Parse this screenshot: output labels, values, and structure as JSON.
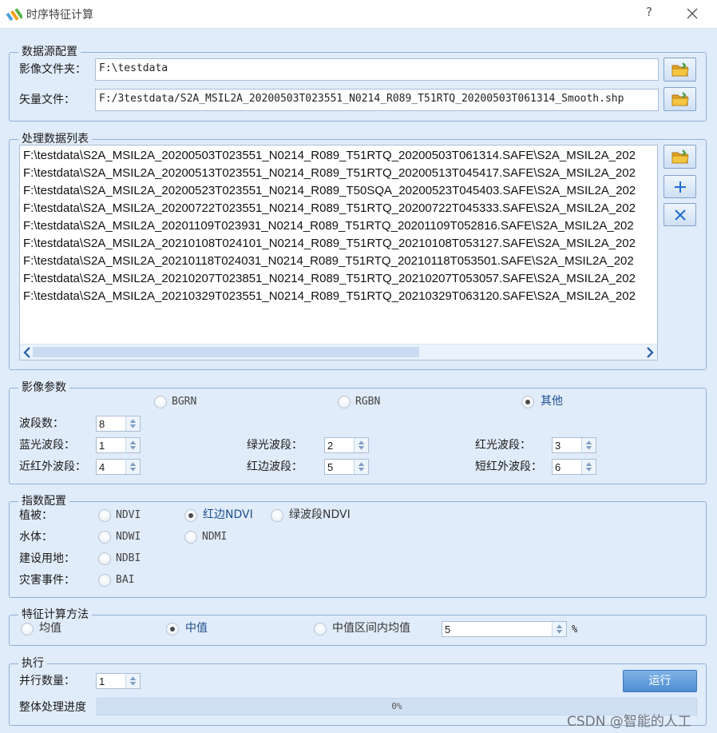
{
  "window": {
    "title": "时序特征计算",
    "help_label": "?"
  },
  "data_source": {
    "group_title": "数据源配置",
    "image_folder_label": "影像文件夹：",
    "image_folder_value": "F:\\testdata",
    "vector_file_label": "矢量文件：",
    "vector_file_value": "F:/3testdata/S2A_MSIL2A_20200503T023551_N0214_R089_T51RTQ_20200503T061314_Smooth.shp"
  },
  "data_list": {
    "group_title": "处理数据列表",
    "items": [
      "F:\\testdata\\S2A_MSIL2A_20200503T023551_N0214_R089_T51RTQ_20200503T061314.SAFE\\S2A_MSIL2A_202",
      "F:\\testdata\\S2A_MSIL2A_20200513T023551_N0214_R089_T51RTQ_20200513T045417.SAFE\\S2A_MSIL2A_202",
      "F:\\testdata\\S2A_MSIL2A_20200523T023551_N0214_R089_T50SQA_20200523T045403.SAFE\\S2A_MSIL2A_202",
      "F:\\testdata\\S2A_MSIL2A_20200722T023551_N0214_R089_T51RTQ_20200722T045333.SAFE\\S2A_MSIL2A_202",
      "F:\\testdata\\S2A_MSIL2A_20201109T023931_N0214_R089_T51RTQ_20201109T052816.SAFE\\S2A_MSIL2A_202",
      "F:\\testdata\\S2A_MSIL2A_20210108T024101_N0214_R089_T51RTQ_20210108T053127.SAFE\\S2A_MSIL2A_202",
      "F:\\testdata\\S2A_MSIL2A_20210118T024031_N0214_R089_T51RTQ_20210118T053501.SAFE\\S2A_MSIL2A_202",
      "F:\\testdata\\S2A_MSIL2A_20210207T023851_N0214_R089_T51RTQ_20210207T053057.SAFE\\S2A_MSIL2A_202",
      "F:\\testdata\\S2A_MSIL2A_20210329T023551_N0214_R089_T51RTQ_20210329T063120.SAFE\\S2A_MSIL2A_202"
    ]
  },
  "image_params": {
    "group_title": "影像参数",
    "band_order_options": [
      "BGRN",
      "RGBN",
      "其他"
    ],
    "band_order_selected": "其他",
    "band_count_label": "波段数：",
    "band_count_value": "8",
    "blue_label": "蓝光波段：",
    "blue_value": "1",
    "green_label": "绿光波段：",
    "green_value": "2",
    "red_label": "红光波段：",
    "red_value": "3",
    "nir_label": "近红外波段：",
    "nir_value": "4",
    "rededge_label": "红边波段：",
    "rededge_value": "5",
    "swir_label": "短红外波段：",
    "swir_value": "6"
  },
  "index_config": {
    "group_title": "指数配置",
    "vegetation_label": "植被：",
    "vegetation_options": [
      "NDVI",
      "红边NDVI",
      "绿波段NDVI"
    ],
    "vegetation_selected": "红边NDVI",
    "water_label": "水体：",
    "water_options": [
      "NDWI",
      "NDMI"
    ],
    "builtup_label": "建设用地：",
    "builtup_options": [
      "NDBI"
    ],
    "disaster_label": "灾害事件：",
    "disaster_options": [
      "BAI"
    ]
  },
  "feature_method": {
    "group_title": "特征计算方法",
    "options": [
      "均值",
      "中值",
      "中值区间内均值"
    ],
    "selected": "中值",
    "interval_value": "5",
    "interval_unit": "%"
  },
  "execute": {
    "group_title": "执行",
    "parallel_label": "并行数量：",
    "parallel_value": "1",
    "run_label": "运行",
    "progress_label": "整体处理进度",
    "progress_fraction": 0,
    "progress_text": "0%"
  },
  "watermark": "CSDN @智能的人工",
  "colors": {
    "accent": "#4d8fd3",
    "background": "#e1ecfa",
    "group_border": "#8fb0d6"
  },
  "icons": [
    "app-logo-icon",
    "help-icon",
    "close-icon",
    "folder-open-icon",
    "plus-icon",
    "delete-icon",
    "chevron-left-icon",
    "chevron-right-icon",
    "spin-arrows-icon"
  ]
}
